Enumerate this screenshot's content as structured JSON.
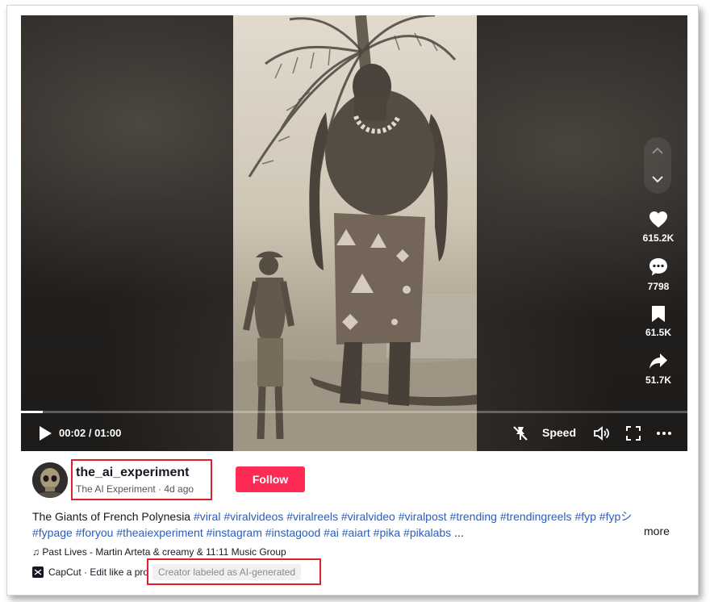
{
  "player": {
    "time_current": "00:02",
    "time_separator": " / ",
    "time_total": "01:00",
    "time_display": "00:02 / 01:00",
    "progress_fraction": 0.033,
    "speed_label": "Speed",
    "actions": [
      {
        "icon": "heart-icon",
        "count": "615.2K"
      },
      {
        "icon": "comment-icon",
        "count": "7798"
      },
      {
        "icon": "bookmark-icon",
        "count": "61.5K"
      },
      {
        "icon": "share-icon",
        "count": "51.7K"
      }
    ]
  },
  "author": {
    "username": "the_ai_experiment",
    "display_name": "The AI Experiment",
    "posted": "4d ago",
    "subline": "The AI Experiment · 4d ago",
    "follow_label": "Follow"
  },
  "caption": {
    "text": "The Giants of French Polynesia",
    "hashtags": [
      "#viral",
      "#viralvideos",
      "#viralreels",
      "#viralvideo",
      "#viralpost",
      "#trending",
      "#trendingreels",
      "#fyp",
      "#fypシ",
      "#fypage",
      "#foryou",
      "#theaiexperiment",
      "#instagram",
      "#instagood",
      "#ai",
      "#aiart",
      "#pika",
      "#pikalabs"
    ],
    "ellipsis": "...",
    "more_label": "more"
  },
  "music": "♫ Past Lives - Martin Arteta & creamy & 11:11 Music Group",
  "capcut": "CapCut · Edit like a pro",
  "ai_label": "Creator labeled as AI-generated",
  "colors": {
    "follow": "#fe2c55",
    "hashtag": "#2b5db9",
    "highlight_box": "#e0202c"
  }
}
